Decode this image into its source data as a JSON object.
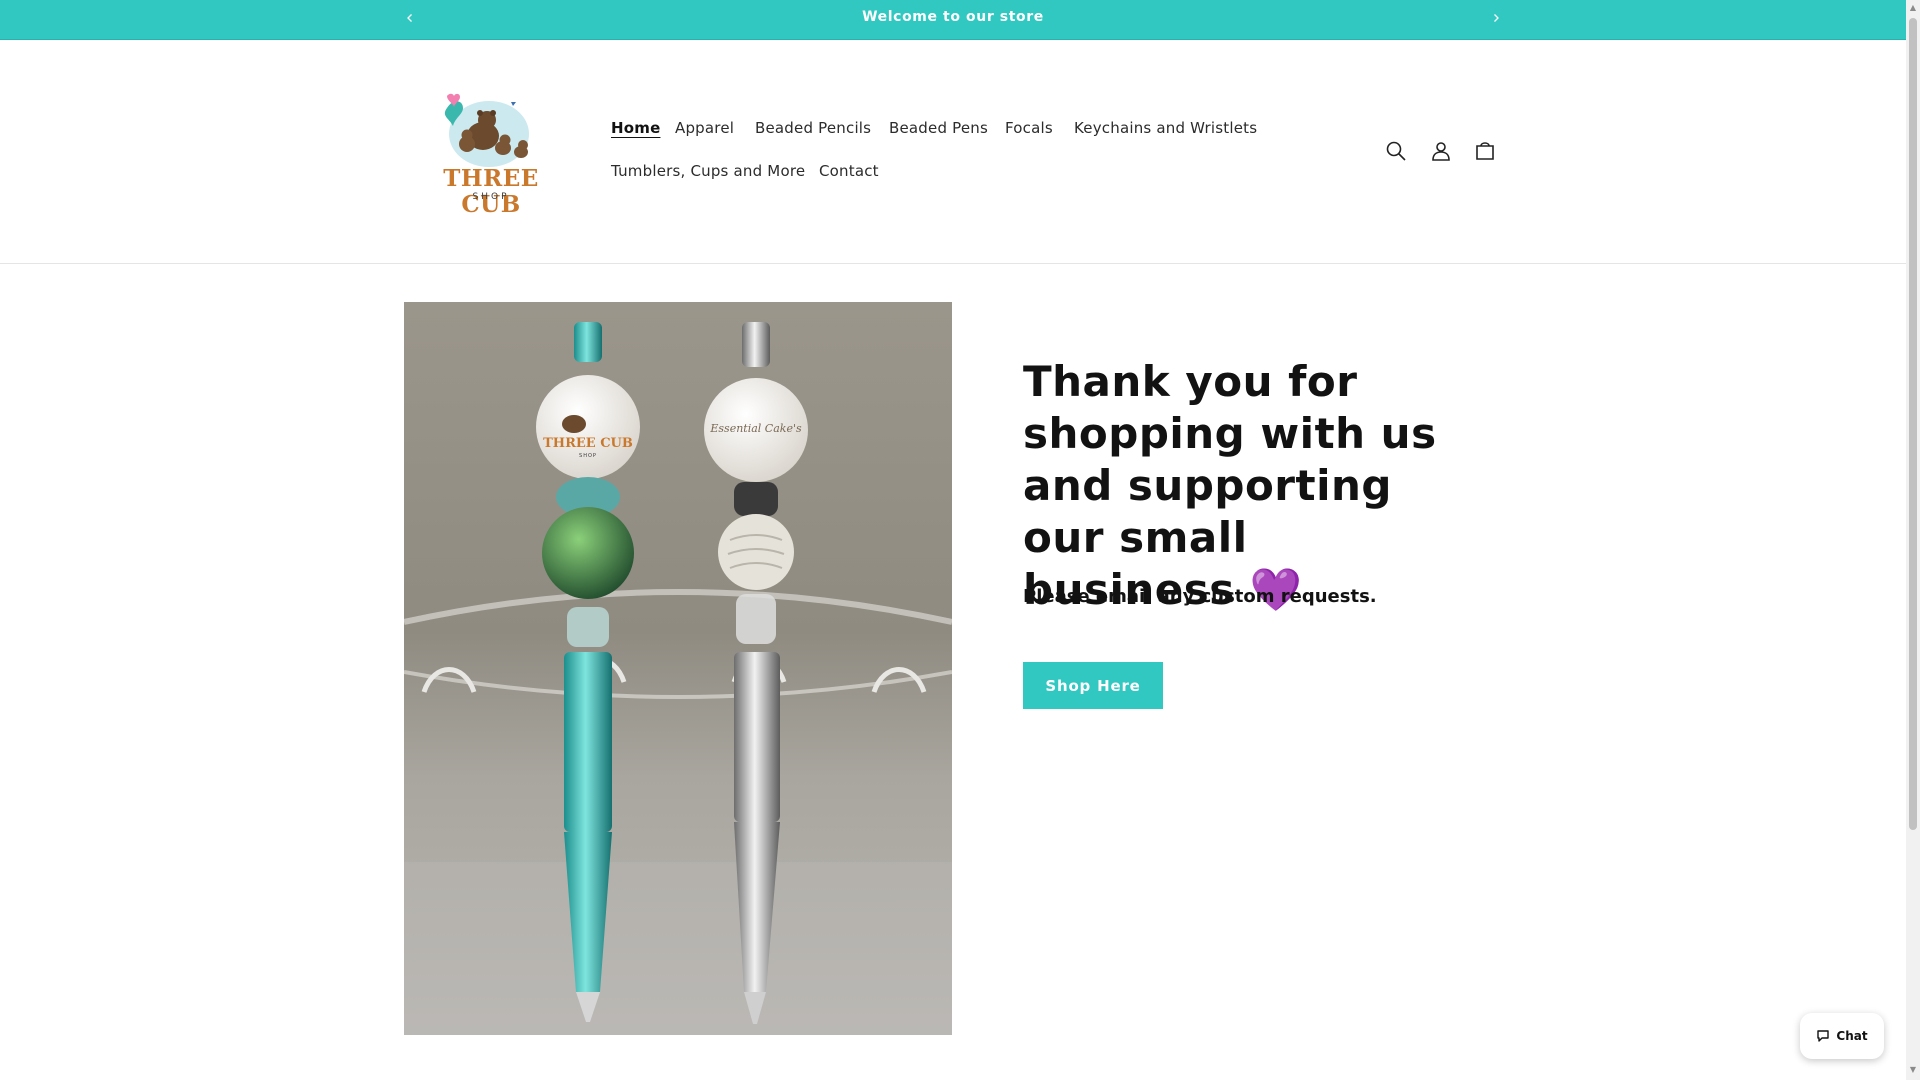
{
  "announcement": {
    "text": "Welcome to our store"
  },
  "logo": {
    "name": "THREE CUB",
    "subtitle": "SHOP"
  },
  "nav": {
    "items": [
      {
        "label": "Home",
        "active": true
      },
      {
        "label": "Apparel"
      },
      {
        "label": "Beaded Pencils"
      },
      {
        "label": "Beaded Pens"
      },
      {
        "label": "Focals"
      },
      {
        "label": "Keychains and Wristlets"
      },
      {
        "label": "Tumblers, Cups and More"
      },
      {
        "label": "Contact"
      }
    ]
  },
  "header_icons": [
    "search-icon",
    "account-icon",
    "cart-icon"
  ],
  "hero": {
    "title": "Thank you for shopping with us and supporting our small business 💜",
    "subtitle": "Please email any custom requests.",
    "button_label": "Shop Here",
    "image_text": {
      "left_focal": "THREE CUB",
      "left_focal_sub": "SHOP",
      "right_focal": "Essential Cake's"
    }
  },
  "chat": {
    "label": "Chat"
  },
  "colors": {
    "accent": "#30c8c1",
    "text": "#121212",
    "background": "#ffffff"
  }
}
